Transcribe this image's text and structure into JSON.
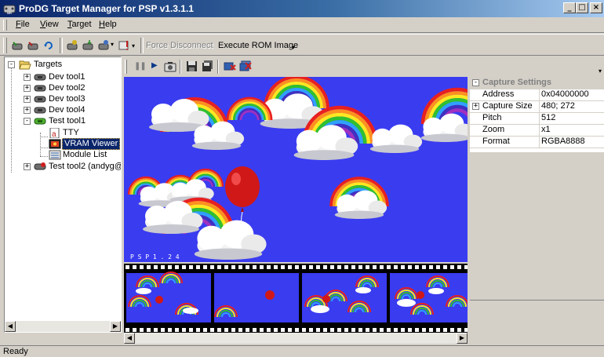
{
  "window": {
    "title": "ProDG Target Manager for PSP v1.3.1.1",
    "min": "_",
    "max": "□",
    "close": "×"
  },
  "menu": [
    {
      "key": "F",
      "rest": "ile"
    },
    {
      "key": "V",
      "rest": "iew"
    },
    {
      "key": "T",
      "rest": "arget"
    },
    {
      "key": "H",
      "rest": "elp"
    }
  ],
  "toolbar": {
    "force_disconnect": "Force Disconnect",
    "execute_rom": "Execute ROM Image"
  },
  "tree": {
    "root": "Targets",
    "items": [
      "Dev tool1",
      "Dev tool2",
      "Dev tool3",
      "Dev tool4",
      "Test tool1",
      "TTY",
      "VRAM Viewer",
      "Module List",
      "Test tool2 (andyg@c"
    ]
  },
  "viewer": {
    "overlay_text": "P S P 1 . 2 4"
  },
  "properties": {
    "header": "Capture Settings",
    "rows": [
      {
        "name": "Address",
        "value": "0x04000000"
      },
      {
        "name": "Capture Size",
        "value": "480; 272"
      },
      {
        "name": "Pitch",
        "value": "512"
      },
      {
        "name": "Zoom",
        "value": "x1"
      },
      {
        "name": "Format",
        "value": "RGBA8888"
      }
    ]
  },
  "status": "Ready",
  "colors": {
    "title_start": "#0a246a",
    "title_end": "#a6caf0",
    "selection": "#0a246a",
    "sky": "#3a3cf0",
    "chrome": "#d4d0c8"
  }
}
